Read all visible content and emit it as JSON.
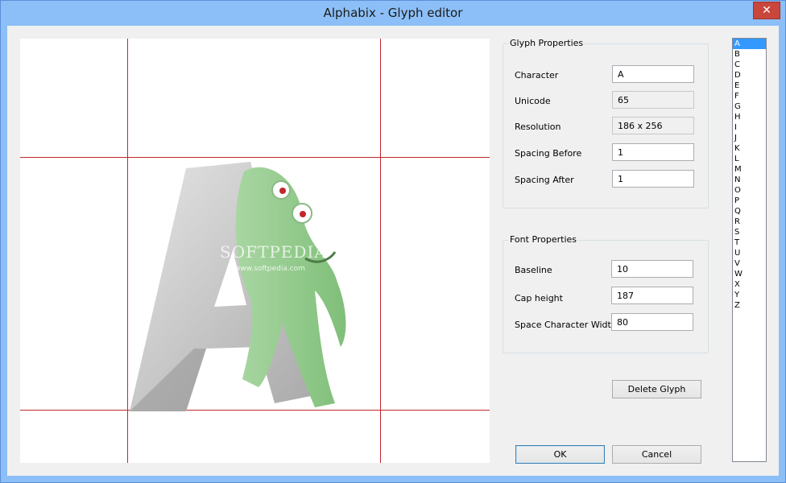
{
  "window": {
    "title": "Alphabix - Glyph editor",
    "close_label": "✕"
  },
  "canvas": {
    "watermark": "SOFTPEDIA",
    "watermark_url": "www.softpedia.com"
  },
  "glyph_properties": {
    "legend": "Glyph Properties",
    "character": {
      "label": "Character",
      "value": "A"
    },
    "unicode": {
      "label": "Unicode",
      "value": "65"
    },
    "resolution": {
      "label": "Resolution",
      "value": "186 x 256"
    },
    "spacing_before": {
      "label": "Spacing Before",
      "value": "1"
    },
    "spacing_after": {
      "label": "Spacing After",
      "value": "1"
    }
  },
  "font_properties": {
    "legend": "Font Properties",
    "baseline": {
      "label": "Baseline",
      "value": "10"
    },
    "cap_height": {
      "label": "Cap height",
      "value": "187"
    },
    "space_width": {
      "label": "Space Character Width",
      "value": "80"
    }
  },
  "buttons": {
    "delete_glyph": "Delete Glyph",
    "ok": "OK",
    "cancel": "Cancel"
  },
  "glyph_list": {
    "items": [
      "A",
      "B",
      "C",
      "D",
      "E",
      "F",
      "G",
      "H",
      "I",
      "J",
      "K",
      "L",
      "M",
      "N",
      "O",
      "P",
      "Q",
      "R",
      "S",
      "T",
      "U",
      "V",
      "W",
      "X",
      "Y",
      "Z"
    ],
    "selected": "A"
  },
  "colors": {
    "guide_line": "#c1272d",
    "selection": "#3399ff",
    "titlebar": "#8cbff7"
  }
}
